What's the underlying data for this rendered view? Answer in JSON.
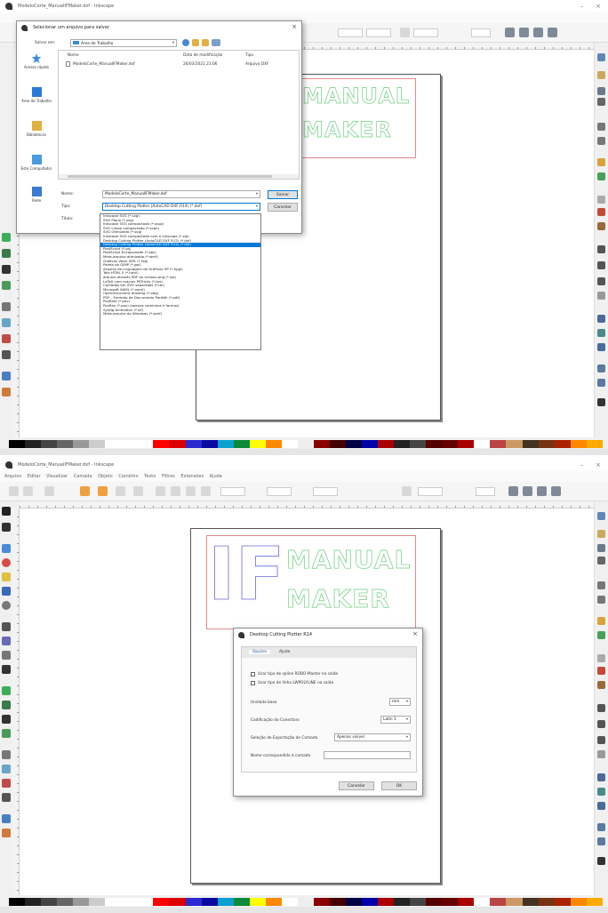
{
  "screen1": {
    "window_title": "ModeloCorte_ManualIFMaker.dxf - Inkscape",
    "logo_text": [
      "MANUAL",
      "MAKER"
    ],
    "save_dialog": {
      "title": "Selecionar um arquivo para salvar",
      "save_in_label": "Salvar em:",
      "save_in_value": "Área de Trabalho",
      "places": [
        "Acesso rápido",
        "Área de Trabalho",
        "Bibliotecas",
        "Este Computador",
        "Rede"
      ],
      "columns": [
        "Nome",
        "Data de modificação",
        "Tipo"
      ],
      "files": [
        {
          "name": "ModeloCorte_ManualIFMaker.dxf",
          "date": "26/03/2021 21:06",
          "type": "Arquivo DXF"
        }
      ],
      "name_label": "Nome:",
      "name_value": "ModeloCorte_ManualIFMaker.dxf",
      "type_label": "Tipo:",
      "type_value": "Desktop Cutting Plotter (AutoCAD DXF R14) (*.dxf)",
      "title_label": "Título:",
      "save_button": "Salvar",
      "cancel_button": "Cancelar",
      "file_types": [
        "Inkscape SVG (*.svg)",
        "SVG Plano (*.svg)",
        "Inkscape SVG compactado (*.svgz)",
        "SVG Limpo compactado (*.svgz)",
        "SVG Otimizado (*.svg)",
        "Inkscape SVG compactado com o Inkscape (*.zip)",
        "Desktop Cutting Plotter (AutoCAD DXF R12) (*.dxf)",
        "Desktop Cutting Plotter (AutoCAD DXF R14) (*.dxf)",
        "PostScript (*.ps)",
        "PostScript Encapsulado (*.eps)",
        "Meta-arquivo otimizado (*.wmf)",
        "Gráficos Vetor XML (*.fxg)",
        "Paleta do GIMP (*.gpl)",
        "Arquivo de Linguagem de Gráficos HP (*.hpgl)",
        "Tela HTML 5 (*.html)",
        "arquivo através PDF ou scribus.png (*.sla)",
        "LaTeX com macros PSTricks (*.tex)",
        "Camadas em SVG separadas (*.tar)",
        "Microsoft XAML (*.xaml)",
        "OpenDocument drawing (*.odg)",
        "PDF - Formato de Documento Portátil (*.pdf)",
        "PovRaid (*.pov)",
        "PovRay (*.pov) (apenas caminhos e formas)",
        "Synfig Animation (*.sif)",
        "Meta-arquivo do Windows (*.wmf)"
      ],
      "selected_type_index": 7
    }
  },
  "screen2": {
    "window_title": "ModeloCorte_ManualIFMaker.dxf - Inkscape",
    "menu": [
      "Arquivo",
      "Editar",
      "Visualizar",
      "Camada",
      "Objeto",
      "Caminho",
      "Texto",
      "Filtros",
      "Extensões",
      "Ajuda"
    ],
    "logo_big": "IF",
    "logo_text": [
      "MANUAL",
      "MAKER"
    ],
    "dxf_dialog": {
      "title": "Desktop Cutting Plotter R14",
      "tabs": [
        "Opções",
        "Ajuda"
      ],
      "options": [
        "Usar tipo de spline ROBO-Master na saída",
        "Usar tipo de linha LWPOLYLINE na saída"
      ],
      "base_unit_label": "Unidade base",
      "base_unit_value": "mm",
      "encoding_label": "Codificação do Conectorx",
      "encoding_value": "Latin 1",
      "layer_export_label": "Seleção de Exportação de Camada",
      "layer_export_value": "Apenas visível",
      "layer_match_label": "Nome correspondido à camada",
      "layer_match_value": "",
      "cancel_button": "Cancelar",
      "ok_button": "OK"
    }
  },
  "colors": {
    "logo_green": "#6fcf7f",
    "logo_blue": "#6b6bd6",
    "bbox_red": "#e68a8a",
    "selection_blue": "#0078d7"
  }
}
